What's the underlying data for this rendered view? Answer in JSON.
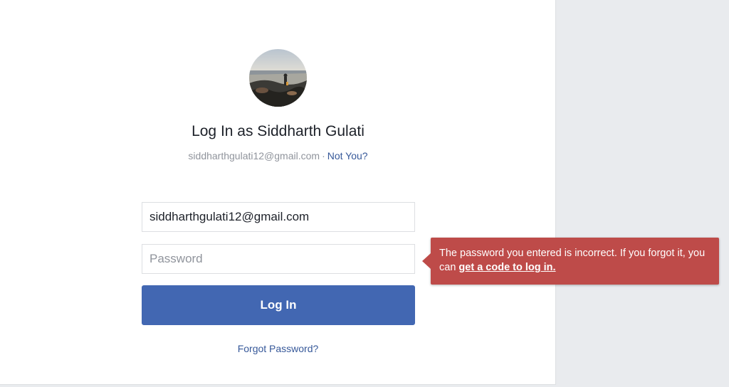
{
  "profile": {
    "title": "Log In as Siddharth Gulati",
    "email": "siddharthgulati12@gmail.com",
    "separator": "·",
    "not_you": "Not You?"
  },
  "form": {
    "email_value": "siddharthgulati12@gmail.com",
    "password_placeholder": "Password",
    "login_label": "Log In",
    "forgot_label": "Forgot Password?"
  },
  "error": {
    "message": "The password you entered is incorrect. If you forgot it, you can",
    "link": "get a code to log in."
  },
  "colors": {
    "brand": "#4267b2",
    "link": "#365899",
    "error": "#be4b49",
    "background": "#e9ebee"
  },
  "icons": {
    "avatar": "profile-photo"
  }
}
